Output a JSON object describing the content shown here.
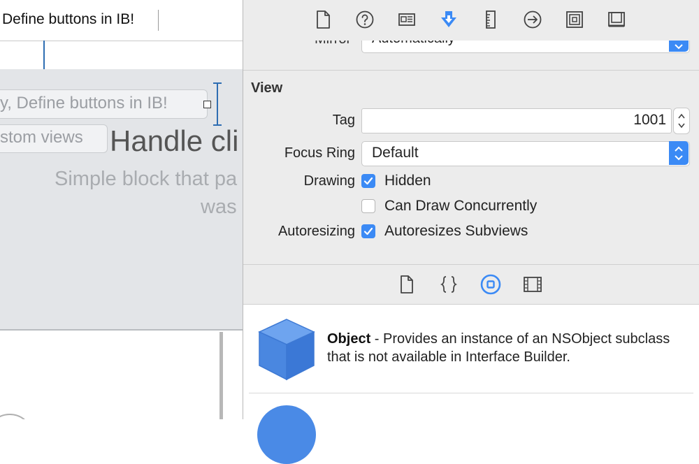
{
  "canvas": {
    "title": "Define buttons in IB!",
    "pill1_text": "y, Define buttons in IB!",
    "pill2_text": "stom views",
    "handle_title": "Handle cli",
    "simple_line1": "Simple block that pa",
    "simple_line2": "was"
  },
  "inspector": {
    "tabs": [
      {
        "name": "file-inspector",
        "icon": "document-icon"
      },
      {
        "name": "quick-help",
        "icon": "question-circle-icon"
      },
      {
        "name": "identity-inspector",
        "icon": "identity-card-icon"
      },
      {
        "name": "attributes-inspector",
        "icon": "attributes-icon",
        "active": true
      },
      {
        "name": "size-inspector",
        "icon": "ruler-icon"
      },
      {
        "name": "connections-inspector",
        "icon": "arrow-circle-icon"
      },
      {
        "name": "bindings-inspector",
        "icon": "bindings-icon"
      },
      {
        "name": "view-effects-inspector",
        "icon": "view-effects-icon"
      }
    ],
    "mirror": {
      "label": "Mirror",
      "value": "Automatically"
    },
    "section_title": "View",
    "tag": {
      "label": "Tag",
      "value": "1001"
    },
    "focus_ring": {
      "label": "Focus Ring",
      "value": "Default"
    },
    "drawing": {
      "label": "Drawing",
      "hidden_label": "Hidden",
      "hidden_checked": true,
      "concurrent_label": "Can Draw Concurrently",
      "concurrent_checked": false
    },
    "autoresizing": {
      "label": "Autoresizing",
      "subviews_label": "Autoresizes Subviews",
      "subviews_checked": true
    }
  },
  "library": {
    "tabs": [
      {
        "name": "file-template-library",
        "icon": "document-icon"
      },
      {
        "name": "code-snippet-library",
        "icon": "braces-icon"
      },
      {
        "name": "object-library",
        "icon": "object-circle-icon",
        "active": true
      },
      {
        "name": "media-library",
        "icon": "film-icon"
      }
    ],
    "items": [
      {
        "title": "Object",
        "description": " - Provides an instance of an NSObject subclass that is not available in Interface Builder."
      }
    ]
  },
  "colors": {
    "accent": "#3b8af5",
    "constraint": "#2e6db2",
    "canvas_gray": "#e3e5e8",
    "inspector_bg": "#ececec"
  }
}
